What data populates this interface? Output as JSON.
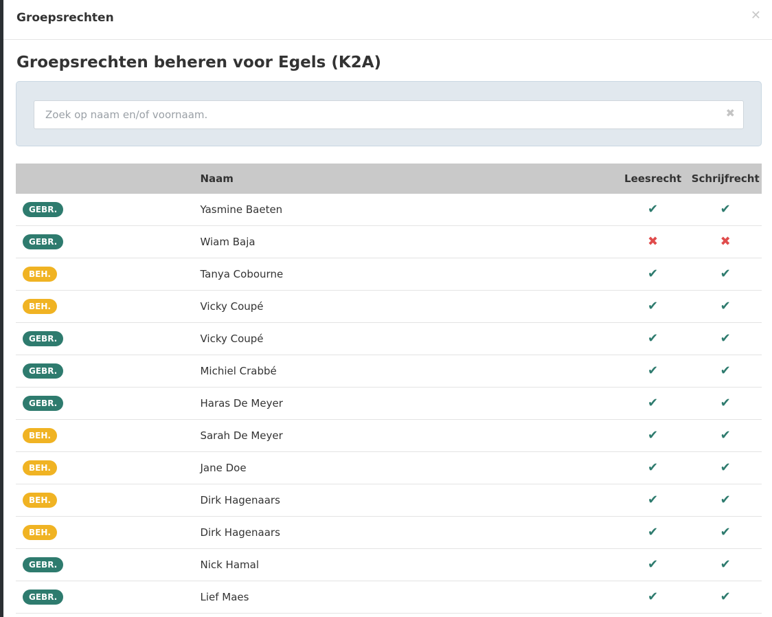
{
  "dialog": {
    "title": "Groepsrechten",
    "close_icon": "close-icon"
  },
  "heading": "Groepsrechten beheren voor Egels (K2A)",
  "search": {
    "placeholder": "Zoek op naam en/of voornaam.",
    "value": "",
    "clear_icon": "clear-icon"
  },
  "table": {
    "headers": {
      "badge": "",
      "name": "Naam",
      "read": "Leesrecht",
      "write": "Schrijfrecht"
    },
    "rows": [
      {
        "role": "GEBR.",
        "name": "Yasmine Baeten",
        "read": true,
        "write": true
      },
      {
        "role": "GEBR.",
        "name": "Wiam Baja",
        "read": false,
        "write": false
      },
      {
        "role": "BEH.",
        "name": "Tanya Cobourne",
        "read": true,
        "write": true
      },
      {
        "role": "BEH.",
        "name": "Vicky Coupé",
        "read": true,
        "write": true
      },
      {
        "role": "GEBR.",
        "name": "Vicky Coupé",
        "read": true,
        "write": true
      },
      {
        "role": "GEBR.",
        "name": "Michiel Crabbé",
        "read": true,
        "write": true
      },
      {
        "role": "GEBR.",
        "name": "Haras De Meyer",
        "read": true,
        "write": true
      },
      {
        "role": "BEH.",
        "name": "Sarah De Meyer",
        "read": true,
        "write": true
      },
      {
        "role": "BEH.",
        "name": "Jane Doe",
        "read": true,
        "write": true
      },
      {
        "role": "BEH.",
        "name": "Dirk Hagenaars",
        "read": true,
        "write": true
      },
      {
        "role": "BEH.",
        "name": "Dirk Hagenaars",
        "read": true,
        "write": true
      },
      {
        "role": "GEBR.",
        "name": "Nick Hamal",
        "read": true,
        "write": true
      },
      {
        "role": "GEBR.",
        "name": "Lief Maes",
        "read": true,
        "write": true
      }
    ]
  },
  "colors": {
    "gebr": "#2e7b6e",
    "beh": "#f0b323",
    "yes": "#2e7b6e",
    "no": "#e04c4c"
  }
}
